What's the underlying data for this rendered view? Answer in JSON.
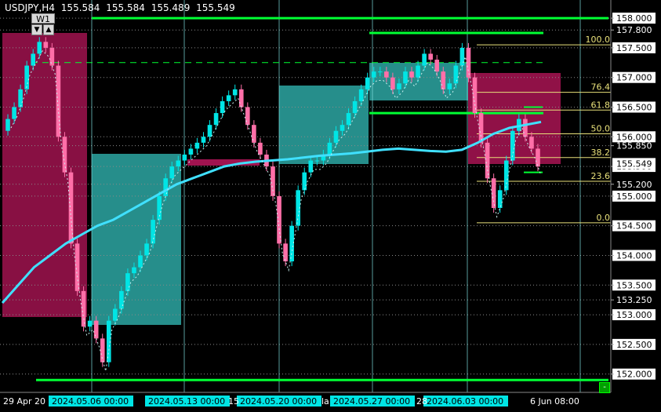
{
  "header": {
    "symbol_tf": "USDJPY,H4",
    "open": "155.584",
    "high": "155.584",
    "low": "155.489",
    "close": "155.549",
    "tf_button": "W1"
  },
  "price_axis": {
    "min": 151.85,
    "max": 158.2,
    "labels": [
      "158.000",
      "157.800",
      "157.500",
      "157.000",
      "156.500",
      "156.000",
      "155.850",
      "155.500",
      "155.200",
      "155.000",
      "154.500",
      "154.000",
      "153.500",
      "153.250",
      "153.000",
      "152.500",
      "152.000"
    ],
    "highlighted": [
      "158.000",
      "157.500",
      "157.000",
      "156.500",
      "156.000",
      "155.500",
      "155.000",
      "154.500",
      "154.000",
      "153.500",
      "153.000",
      "152.500",
      "152.000"
    ],
    "current_price": "155.549"
  },
  "time_axis": {
    "labels": [
      "29 Apr 20",
      "2024.05.06 00:00",
      "2024.05.13 00:00",
      "2024.05.20 00:00",
      "2024.05.27 00:00",
      "2024.06.03 00:00",
      "6 Jun 08:00"
    ],
    "highlighted": [
      "2024.05.06 00:00",
      "2024.05.13 00:00",
      "2024.05.20 00:00",
      "2024.05.27 00:00",
      "2024.06.03 00:00"
    ],
    "fragments": [
      "15",
      "la",
      "28"
    ]
  },
  "fibonacci": {
    "levels": [
      {
        "label": "100.0",
        "price": 157.55
      },
      {
        "label": "76.4",
        "price": 156.75
      },
      {
        "label": "61.8",
        "price": 156.45
      },
      {
        "label": "50.0",
        "price": 156.05
      },
      {
        "label": "38.2",
        "price": 155.65
      },
      {
        "label": "23.6",
        "price": 155.25
      },
      {
        "label": "0.0",
        "price": 154.55
      }
    ],
    "color": "#e8e07a"
  },
  "colors": {
    "bull": "#00e5e5",
    "bear": "#ff6fa8",
    "ma": "#40e0ff",
    "green_line": "#00ff33",
    "teal_zone": "#2a9d9a",
    "pink_zone": "#a0134f",
    "grid": "#8a8a8a",
    "weekly_sep": "#7fe0e0"
  },
  "chart_data": {
    "type": "candlestick",
    "symbol": "USDJPY",
    "timeframe": "H4",
    "series": [
      {
        "name": "candles",
        "values": [
          156.3,
          156.5,
          156.8,
          157.2,
          157.4,
          157.6,
          157.5,
          157.2,
          156.0,
          155.4,
          154.2,
          153.4,
          152.8,
          152.9,
          152.6,
          152.2,
          152.9,
          153.1,
          153.4,
          153.7,
          153.8,
          154.0,
          154.2,
          154.6,
          155.0,
          155.3,
          155.5,
          155.6,
          155.7,
          155.8,
          155.9,
          156.0,
          156.2,
          156.4,
          156.6,
          156.7,
          156.8,
          156.5,
          156.2,
          155.9,
          155.7,
          155.5,
          155.0,
          154.2,
          153.9,
          154.5,
          155.1,
          155.4,
          155.6,
          155.6,
          155.7,
          155.9,
          156.1,
          156.2,
          156.4,
          156.6,
          156.8,
          157.0,
          157.1,
          157.1,
          157.0,
          156.8,
          156.9,
          157.1,
          157.0,
          157.2,
          157.4,
          157.3,
          157.1,
          156.8,
          156.9,
          157.2,
          157.5,
          157.0,
          156.4,
          155.9,
          155.3,
          154.8,
          155.1,
          155.6,
          156.1,
          156.3,
          156.0,
          155.8,
          155.5
        ]
      }
    ],
    "moving_average": [
      153.2,
      153.5,
      153.8,
      154.0,
      154.2,
      154.35,
      154.5,
      154.6,
      154.75,
      154.9,
      155.05,
      155.2,
      155.3,
      155.4,
      155.5,
      155.55,
      155.58,
      155.6,
      155.62,
      155.65,
      155.68,
      155.7,
      155.72,
      155.75,
      155.78,
      155.8,
      155.78,
      155.76,
      155.75,
      155.78,
      155.9,
      156.05,
      156.15,
      156.2,
      156.25
    ],
    "horizontal_lines": [
      158.0,
      157.75,
      157.25,
      156.4,
      151.9
    ],
    "ylim": [
      151.85,
      158.2
    ]
  }
}
